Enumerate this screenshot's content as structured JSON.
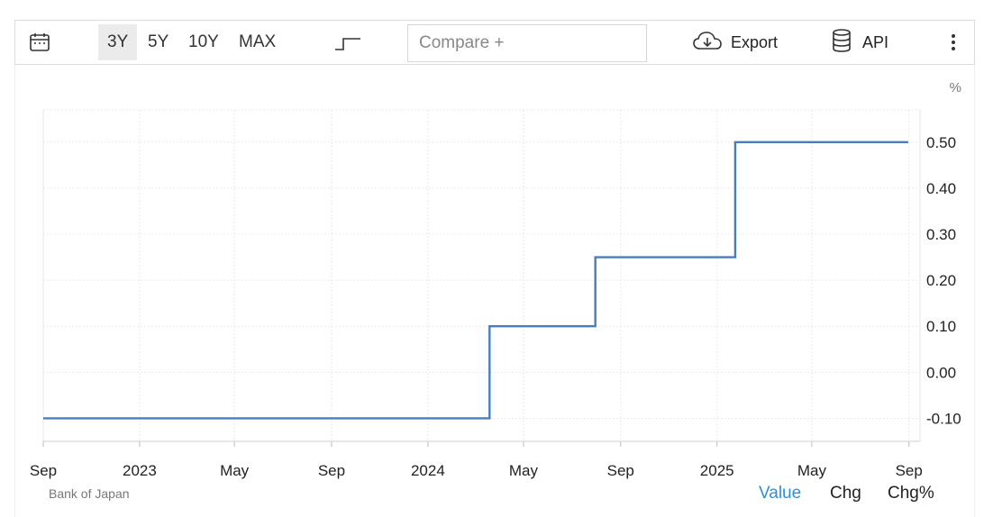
{
  "toolbar": {
    "icons": {
      "calendar": "calendar-icon",
      "step": "step-line-icon",
      "cloud": "cloud-download-icon",
      "database": "database-icon",
      "more": "more-vertical-icon"
    },
    "ranges": [
      {
        "label": "3Y",
        "active": true
      },
      {
        "label": "5Y",
        "active": false
      },
      {
        "label": "10Y",
        "active": false
      },
      {
        "label": "MAX",
        "active": false
      }
    ],
    "compare_placeholder": "Compare +",
    "export_label": "Export",
    "api_label": "API"
  },
  "footer": {
    "source": "Bank of Japan",
    "tabs": [
      {
        "label": "Value",
        "active": true
      },
      {
        "label": "Chg",
        "active": false
      },
      {
        "label": "Chg%",
        "active": false
      }
    ]
  },
  "colors": {
    "line": "#4a7dbf",
    "accent": "#2d8fe0",
    "grid": "#e9e9e9"
  },
  "chart_data": {
    "type": "line",
    "step": true,
    "unit_label": "%",
    "ylim": [
      -0.15,
      0.57
    ],
    "yticks": [
      0.5,
      0.4,
      0.3,
      0.2,
      0.1,
      0.0,
      -0.1
    ],
    "ytick_labels": [
      "0.50",
      "0.40",
      "0.30",
      "0.20",
      "0.10",
      "0.00",
      "-0.10"
    ],
    "xlim": [
      "2022-09-01",
      "2025-09-15"
    ],
    "xticks": [
      {
        "date": "2022-09-01",
        "label": "Sep"
      },
      {
        "date": "2023-01-01",
        "label": "2023"
      },
      {
        "date": "2023-05-01",
        "label": "May"
      },
      {
        "date": "2023-09-01",
        "label": "Sep"
      },
      {
        "date": "2024-01-01",
        "label": "2024"
      },
      {
        "date": "2024-05-01",
        "label": "May"
      },
      {
        "date": "2024-09-01",
        "label": "Sep"
      },
      {
        "date": "2025-01-01",
        "label": "2025"
      },
      {
        "date": "2025-05-01",
        "label": "May"
      },
      {
        "date": "2025-09-01",
        "label": "Sep"
      }
    ],
    "series": [
      {
        "x": [
          "2022-09-01",
          "2024-03-19",
          "2024-07-31",
          "2025-01-24",
          "2025-08-31"
        ],
        "y": [
          -0.1,
          0.1,
          0.25,
          0.5,
          0.5
        ]
      }
    ],
    "grid": true
  }
}
